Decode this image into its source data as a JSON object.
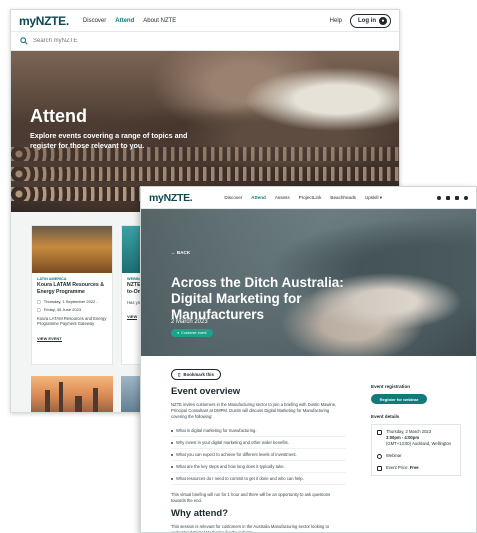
{
  "back": {
    "logo": "myNZTE.",
    "nav": [
      "Discover",
      "Attend",
      "About NZTE"
    ],
    "help": "Help",
    "login": "Log in",
    "search_placeholder": "Search myNZTE",
    "hero": {
      "title": "Attend",
      "subtitle": "Explore events covering a range of topics and register for those relevant to you."
    },
    "cards": [
      {
        "tag": "LATIN AMERICA",
        "title": "Koura LATAM Resources & Energy Programme",
        "date1": "Thursday, 1 September 2022 -",
        "date2": "Friday, 30 June 2023",
        "desc": "Koura LATAM Resources and Energy Programme Payment Gateway",
        "view": "VIEW EVENT"
      },
      {
        "tag": "WEBINAR",
        "title": "NZTE M",
        "title2": "to-One",
        "desc": "Has your financi weathe NZTE h",
        "view": "VIEW"
      }
    ]
  },
  "front": {
    "logo": "myNZTE.",
    "nav": [
      "Discover",
      "Attend",
      "Assess",
      "ProjectLink",
      "Beachheads",
      "Upskill ▾"
    ],
    "back_link": "← BACK",
    "title": "Across the Ditch Australia: Digital Marketing for Manufacturers",
    "date": "2 March 2023",
    "pill": "Customer event",
    "bookmark": "Bookmark this",
    "overview_title": "Event overview",
    "overview_intro": "NZTE invites customers in the Manufacturing sector to join a briefing with Dustin Mawine, Principal Consultant at DMPM. Dustin will discuss Digital Marketing for Manufacturing covering the following:",
    "overview_items": [
      "What is digital marketing for manufacturing.",
      "Why invest in your digital marketing and other wider benefits.",
      "What you can expect to achieve for different levels of investment.",
      "What are the key steps and how long does it typically take.",
      "What resources do I need to commit to get it done and who can help."
    ],
    "overview_outro": "This virtual briefing will run for 1 hour and there will be an opportunity to ask questions towards the end.",
    "why_title": "Why attend?",
    "why_text": "This session is relevant for customers in the Australia Manufacturing sector looking to understand Digital Marketing for the industry.",
    "registration_label": "Event registration",
    "register_button": "Register for webinar",
    "details_label": "Event details",
    "details": {
      "date": "Thursday, 2 March 2023",
      "time": "3:00pm - 4:00pm",
      "timezone": "(GMT+13:00) Auckland, Wellington",
      "format": "Webinar",
      "price_label": "Event Price:",
      "price": "Free"
    }
  },
  "colors": {
    "brand": "#0b4a53",
    "accent": "#127a7a",
    "pill": "#19a38a"
  }
}
